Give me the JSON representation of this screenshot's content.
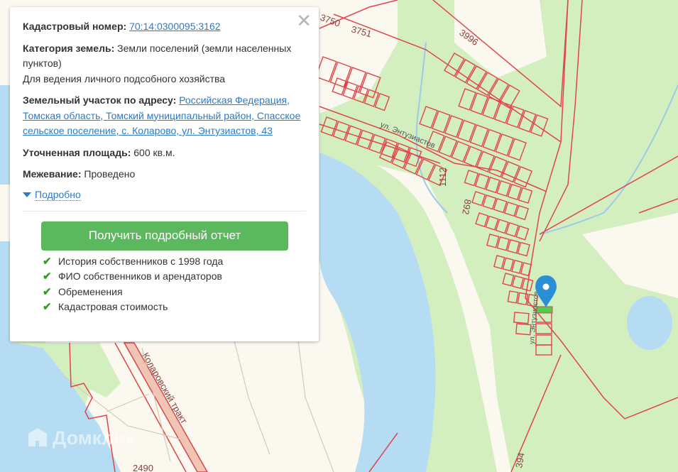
{
  "map": {
    "labels": {
      "p3750": "3750",
      "p3751": "3751",
      "p3996": "3996",
      "p1112": "1112",
      "p892": "892",
      "p2490": "2490",
      "p394": "394",
      "street": "ул. Энтузиастов",
      "street2": "ул. Энтузиастов",
      "road": "Коларовский тракт"
    },
    "watermark": "Домклик",
    "colors": {
      "land": "#faf8ef",
      "forest": "#d3efc0",
      "water": "#b5dcf3",
      "parcel": "#e0454a",
      "marker": "#2b8fd6"
    }
  },
  "popup": {
    "cadastral_label": "Кадастровый номер:",
    "cadastral_value": "70:14:0300095:3162",
    "category_label": "Категория земель:",
    "category_value": "Земли поселений (земли населенных пунктов)",
    "usage": "Для ведения личного подсобного хозяйства",
    "address_label": "Земельный участок по адресу:",
    "address_value": "Российская Федерация, Томская область, Томский муниципальный район, Спасское сельское поселение, с. Коларово, ул. Энтузиастов, 43",
    "area_label": "Уточненная площадь:",
    "area_value": "600 кв.м.",
    "survey_label": "Межевание:",
    "survey_value": "Проведено",
    "more_link": "Подробно",
    "report_button": "Получить подробный отчет",
    "features": [
      "История собственников с 1998 года",
      "ФИО собственников и арендаторов",
      "Обременения",
      "Кадастровая стоимость"
    ],
    "close_icon": "close-icon"
  }
}
